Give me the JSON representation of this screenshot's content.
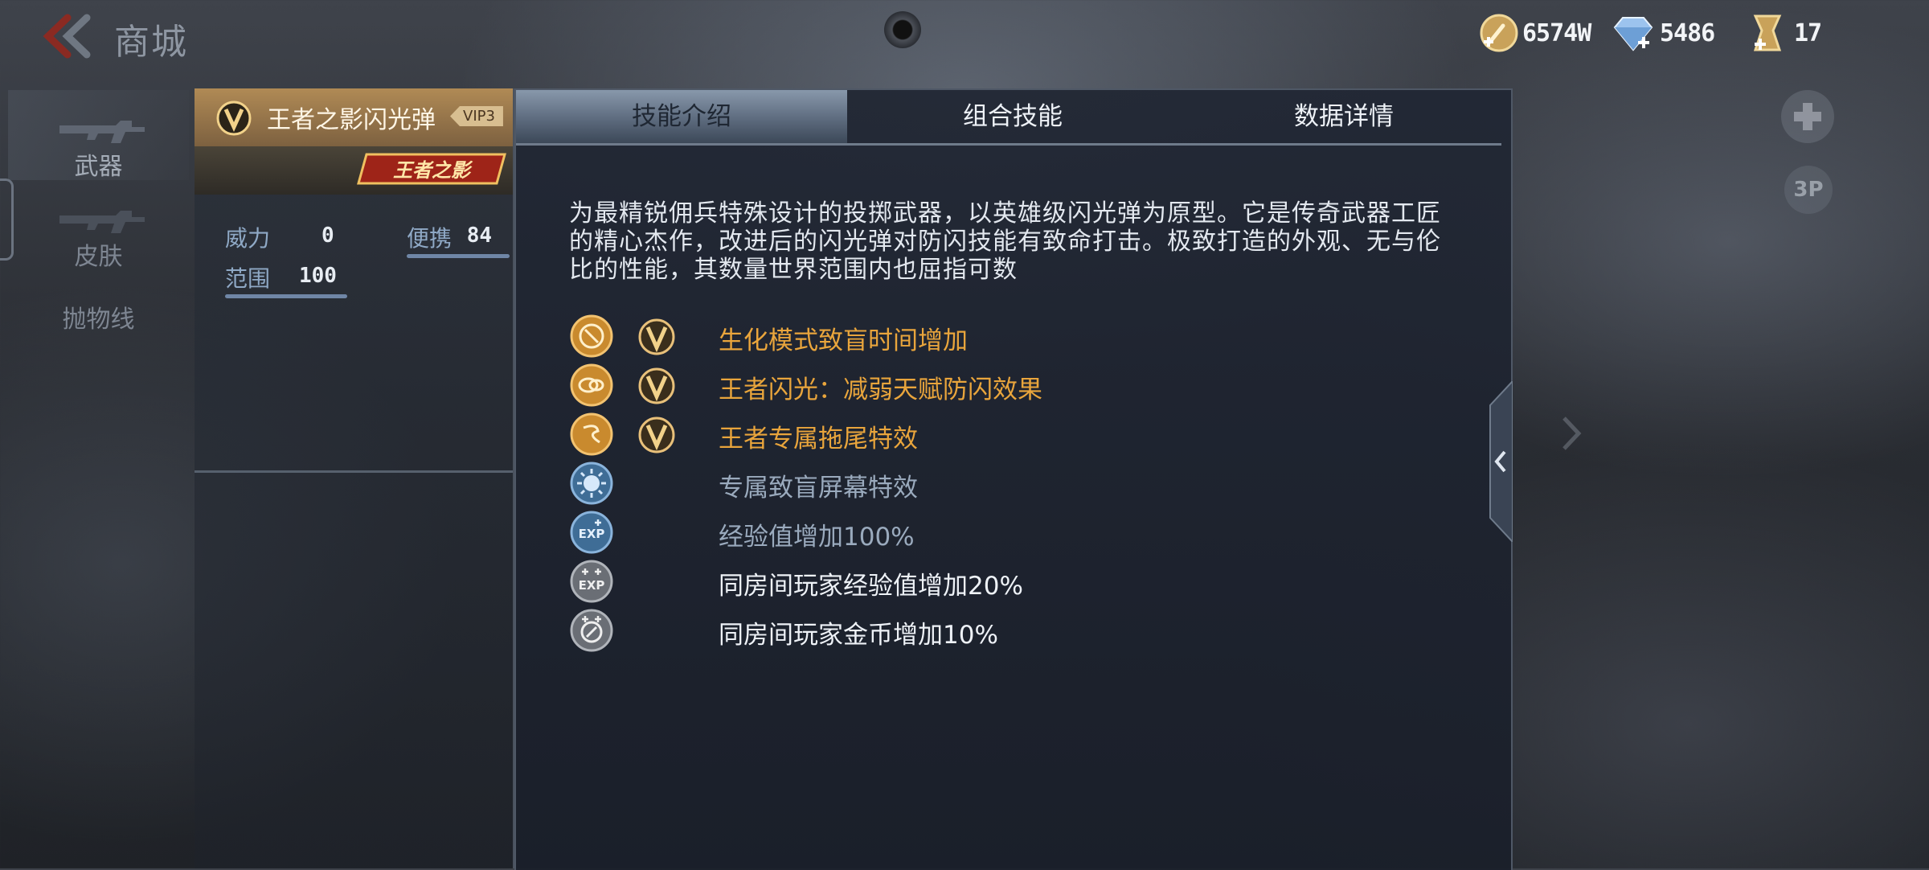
{
  "header": {
    "title": "商城",
    "currencies": [
      {
        "name": "gold",
        "icon": "gold-coin-icon",
        "value": "6574W"
      },
      {
        "name": "diamond",
        "icon": "diamond-icon",
        "value": "5486"
      },
      {
        "name": "ticket",
        "icon": "ticket-icon",
        "value": "17"
      }
    ]
  },
  "nav": {
    "items": [
      {
        "label": "武器",
        "icon": "rifle-icon"
      },
      {
        "label": "皮肤",
        "icon": "rifle-skin-icon"
      },
      {
        "label": "抛物线",
        "icon": "trajectory-icon"
      }
    ]
  },
  "weapon": {
    "name": "王者之影闪光弹",
    "vip": "VIP3",
    "series": "王者之影",
    "stats": [
      {
        "label": "威力",
        "value": "0"
      },
      {
        "label": "便携",
        "value": "84"
      },
      {
        "label": "范围",
        "value": "100"
      }
    ]
  },
  "tabs": [
    "技能介绍",
    "组合技能",
    "数据详情"
  ],
  "description": "为最精锐佣兵特殊设计的投掷武器，以英雄级闪光弹为原型。它是传奇武器工匠的精心杰作，改进后的闪光弹对防闪技能有致命打击。极致打造的外观、无与伦比的性能，其数量世界范围内也屈指可数",
  "skills": [
    {
      "text": "生化模式致盲时间增加",
      "icon": "zombie-mode-icon",
      "tier": "gold",
      "vip": true
    },
    {
      "text": "王者闪光：减弱天赋防闪效果",
      "icon": "king-flash-icon",
      "tier": "gold",
      "vip": true
    },
    {
      "text": "王者专属拖尾特效",
      "icon": "trail-effect-icon",
      "tier": "gold",
      "vip": true
    },
    {
      "text": "专属致盲屏幕特效",
      "icon": "blind-screen-icon",
      "tier": "blue",
      "vip": false
    },
    {
      "text": "经验值增加100%",
      "icon": "exp-icon",
      "tier": "blue",
      "vip": false
    },
    {
      "text": "同房间玩家经验值增加20%",
      "icon": "room-exp-icon",
      "tier": "white",
      "vip": false
    },
    {
      "text": "同房间玩家金币增加10%",
      "icon": "room-gold-icon",
      "tier": "white",
      "vip": false
    }
  ],
  "controls": {
    "view_3p": "3P"
  },
  "colors": {
    "gold": "#e9a53c",
    "blue": "#9aaabd",
    "white": "#eef2f7",
    "stat_label": "#8fa9c6"
  }
}
